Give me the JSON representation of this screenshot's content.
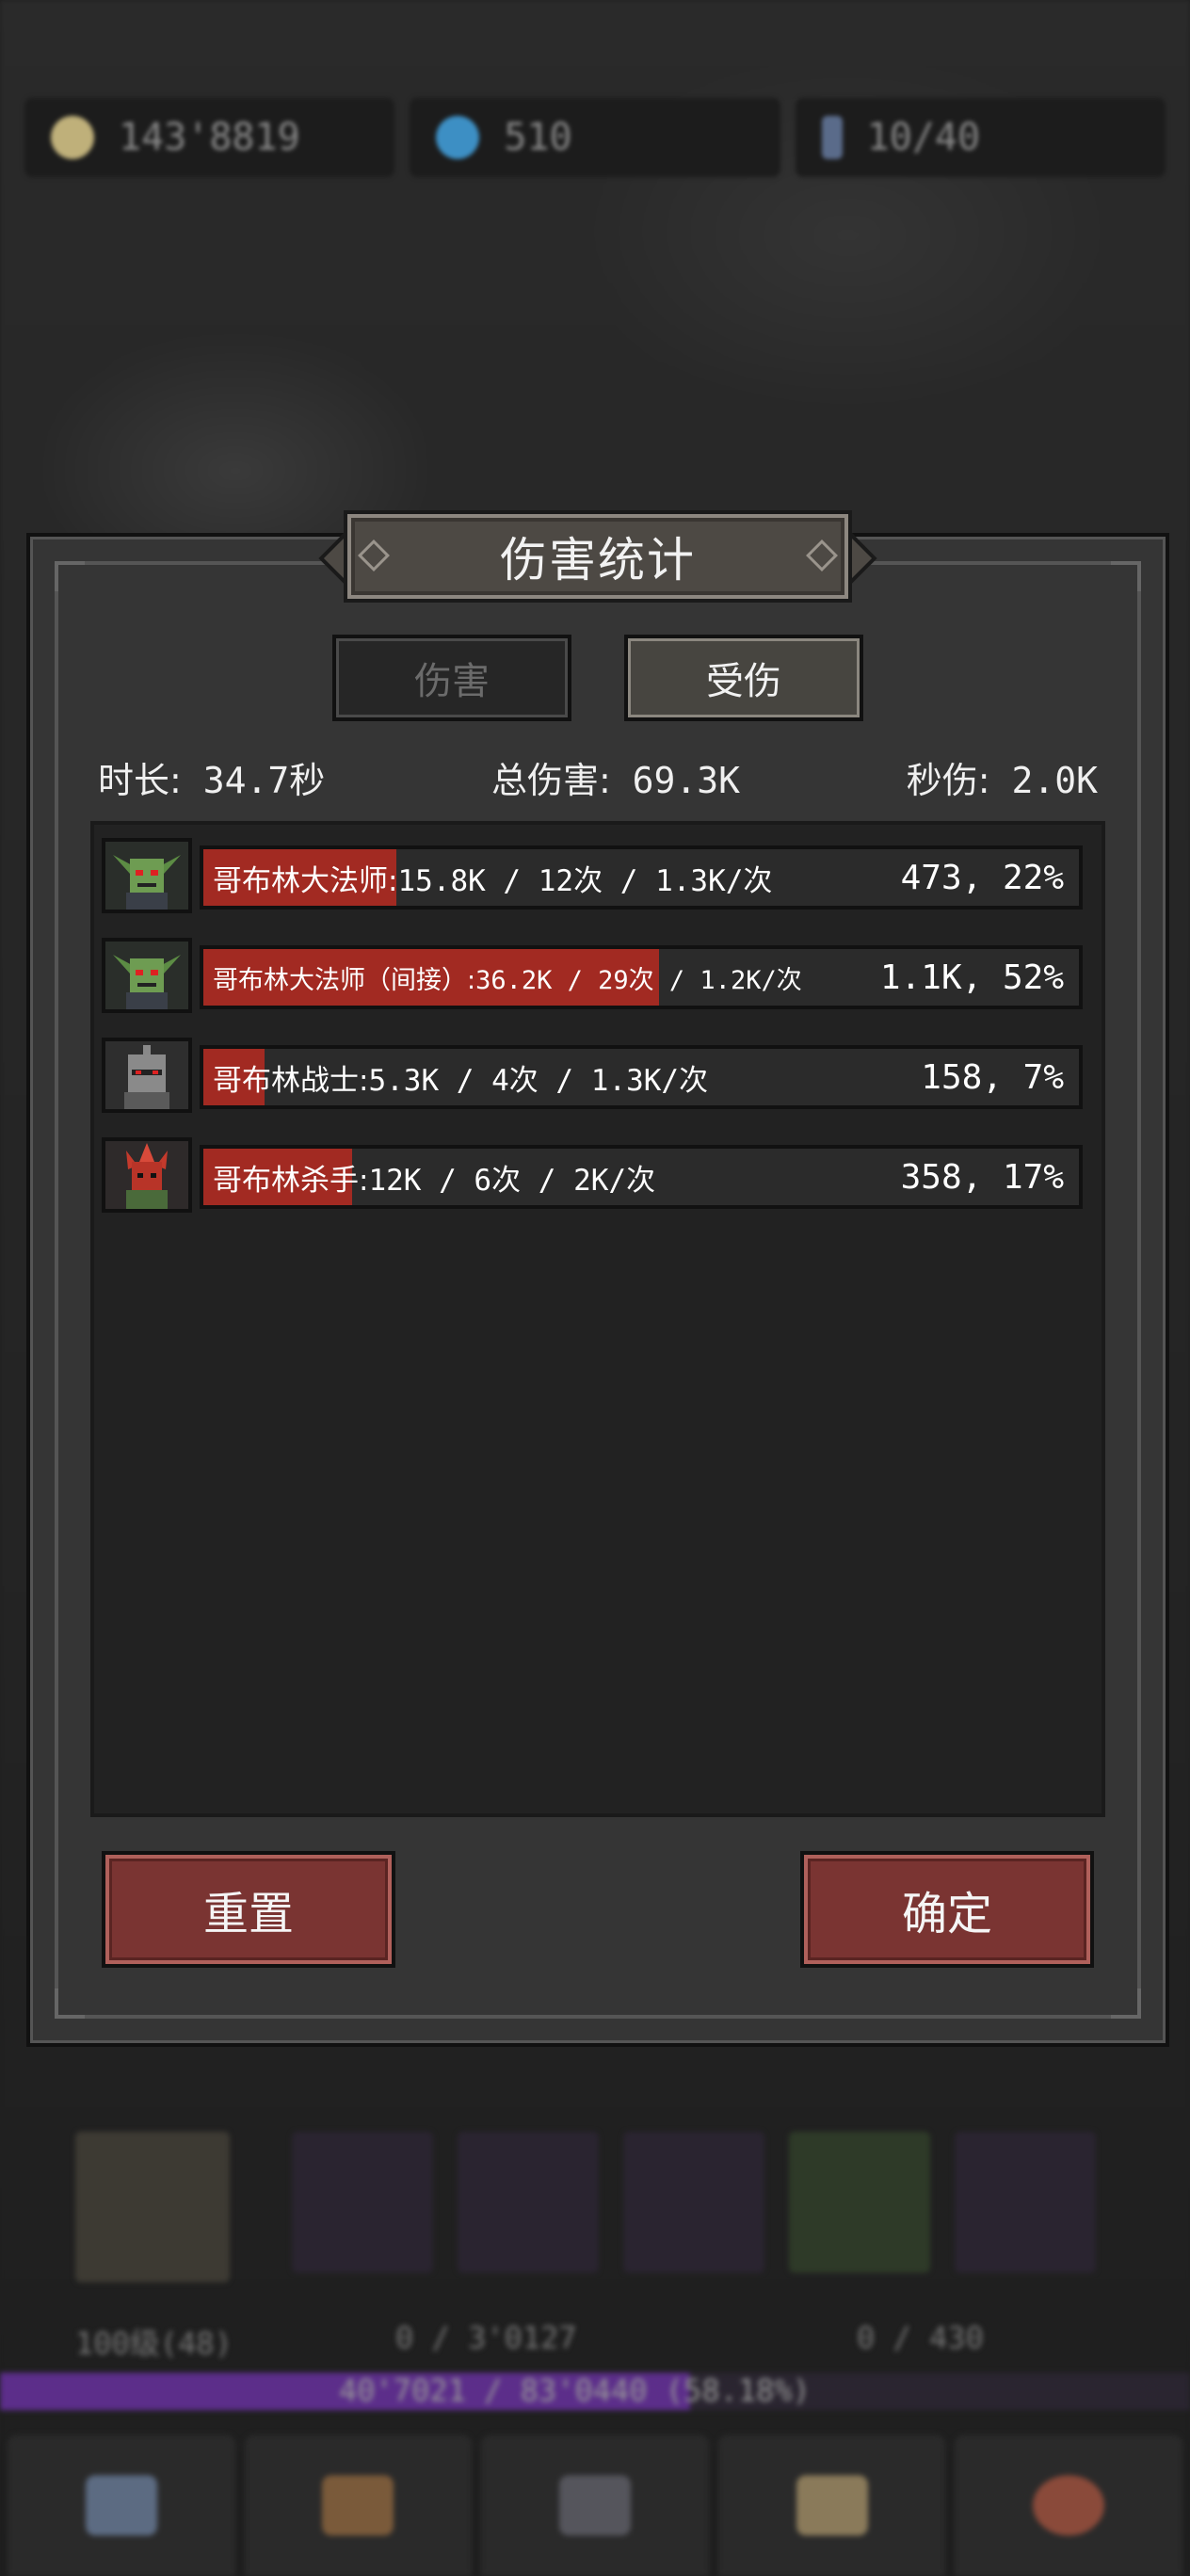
{
  "resources": [
    {
      "icon": "gold-coin-icon",
      "value": "143'8819"
    },
    {
      "icon": "blue-gem-icon",
      "value": "510"
    },
    {
      "icon": "key-icon",
      "value": "10/40"
    }
  ],
  "dialog": {
    "title": "伤害统计",
    "tabs": [
      {
        "label": "伤害",
        "state": "inactive"
      },
      {
        "label": "受伤",
        "state": "active"
      }
    ],
    "stats": {
      "duration_label": "时长:",
      "duration_value": "34.7秒",
      "total_label": "总伤害:",
      "total_value": "69.3K",
      "dps_label": "秒伤:",
      "dps_value": "2.0K"
    },
    "rows": [
      {
        "portrait": "goblin-archmage-portrait-icon",
        "name": "哥布林大法师:",
        "detail": "15.8K / 12次 / 1.3K/次",
        "right": "473, 22%",
        "fill": 0.22
      },
      {
        "portrait": "goblin-archmage-portrait-icon",
        "name": "哥布林大法师（间接）:",
        "detail": "36.2K / 29次 / 1.2K/次",
        "right": "1.1K, 52%",
        "fill": 0.52
      },
      {
        "portrait": "goblin-warrior-portrait-icon",
        "name": "哥布林战士:",
        "detail": "5.3K / 4次 / 1.3K/次",
        "right": "158, 7%",
        "fill": 0.07
      },
      {
        "portrait": "goblin-assassin-portrait-icon",
        "name": "哥布林杀手:",
        "detail": "12K / 6次 / 2K/次",
        "right": "358, 17%",
        "fill": 0.17
      }
    ],
    "buttons": {
      "reset": "重置",
      "confirm": "确定"
    }
  },
  "hud": {
    "hero_level": "100级(48)",
    "progress_left": "0 / 3'0127",
    "progress_right": "0 / 430",
    "xp_text": "40'7021 / 83'0440 (58.18%)",
    "xp_fraction": 0.58,
    "colors": {
      "bar_fill": "#a22a22",
      "button": "#7a3432",
      "xp": "#5c2e8a"
    }
  }
}
